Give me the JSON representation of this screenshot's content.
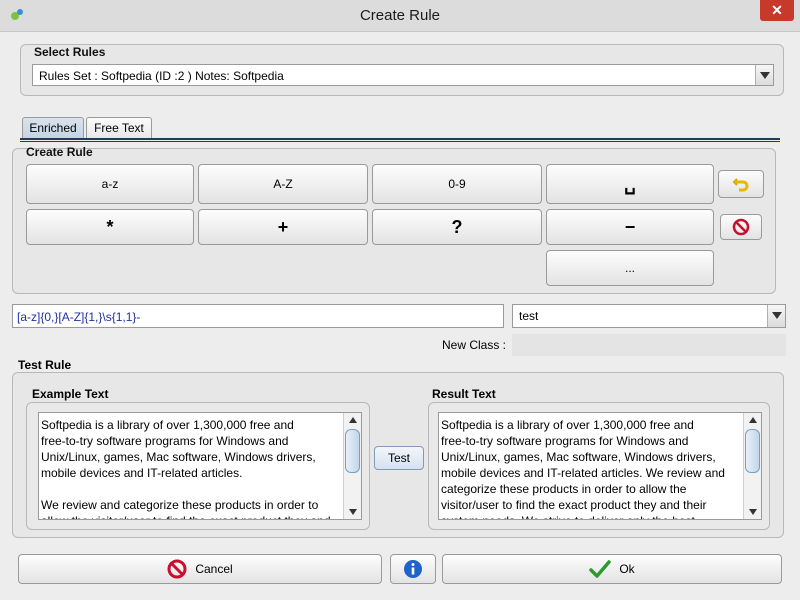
{
  "window": {
    "title": "Create Rule",
    "close": "✕"
  },
  "select_rules": {
    "title": "Select Rules",
    "selected": "Rules Set : Softpedia (ID :2 ) Notes: Softpedia"
  },
  "tabs": [
    {
      "label": "Enriched",
      "active": true
    },
    {
      "label": "Free Text",
      "active": false
    }
  ],
  "create_rule": {
    "title": "Create Rule",
    "buttons": {
      "az": "a-z",
      "AZ": "A-Z",
      "digits": "0-9",
      "space": "␣",
      "star": "*",
      "plus": "+",
      "question": "?",
      "minus": "−",
      "dots": "..."
    }
  },
  "expression": {
    "value": "[a-z]{0,}[A-Z]{1,}\\s{1,1}-",
    "class_selected": "test",
    "new_class_label": "New Class :"
  },
  "test_rule": {
    "title": "Test Rule",
    "example_label": "Example Text",
    "result_label": "Result Text",
    "test_button": "Test",
    "example_text": "Softpedia is a library of over 1,300,000 free and\nfree-to-try software programs for Windows and\nUnix/Linux, games, Mac software, Windows drivers,\nmobile devices and IT-related articles.\n\nWe review and categorize these products in order to\nallow the visitor/user to find the exact product they and",
    "result_text": "Softpedia is a library of over 1,300,000 free and\nfree-to-try software programs for Windows and\nUnix/Linux, games, Mac software, Windows drivers,\nmobile devices and IT-related articles. We review and\ncategorize these products in order to allow the\nvisitor/user to find the exact product they and their\nsystem needs. We strive to deliver only the best"
  },
  "footer": {
    "cancel": "Cancel",
    "ok": "Ok"
  },
  "colors": {
    "accent": "#253a5a",
    "cancel_icon": "#c8102e",
    "ok_icon": "#2e9a2e",
    "info_icon": "#1e63c8"
  }
}
